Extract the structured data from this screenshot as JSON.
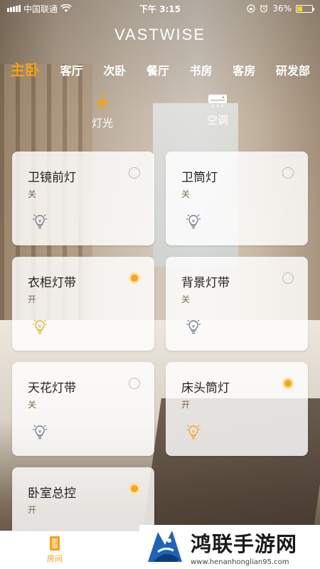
{
  "status_bar": {
    "carrier": "中国联通",
    "time": "下午 3:15",
    "battery": "36%",
    "battery_level": 0.36
  },
  "app": {
    "title": "VASTWISE"
  },
  "rooms": [
    "主卧",
    "客厅",
    "次卧",
    "餐厅",
    "书房",
    "客房",
    "研发部"
  ],
  "active_room": "主卧",
  "device_types": [
    {
      "label": "灯光",
      "icon": "ceiling-light-icon"
    },
    {
      "label": "空调",
      "icon": "air-conditioner-icon"
    }
  ],
  "devices": [
    {
      "name": "卫镜前灯",
      "state": "关",
      "on": false
    },
    {
      "name": "卫筒灯",
      "state": "关",
      "on": false
    },
    {
      "name": "衣柜灯带",
      "state": "开",
      "on": true
    },
    {
      "name": "背景灯带",
      "state": "关",
      "on": false
    },
    {
      "name": "天花灯带",
      "state": "关",
      "on": false
    },
    {
      "name": "床头筒灯",
      "state": "开",
      "on": true
    },
    {
      "name": "卧室总控",
      "state": "开",
      "on": true
    }
  ],
  "tabbar": {
    "home_label": "房间"
  },
  "watermark": {
    "main": "鸿联手游网",
    "sub": "www.henanhonglian95.com"
  },
  "colors": {
    "accent": "#f2a21d",
    "on_dot": "#f5a623",
    "off_bulb": "#6f7b8c"
  }
}
